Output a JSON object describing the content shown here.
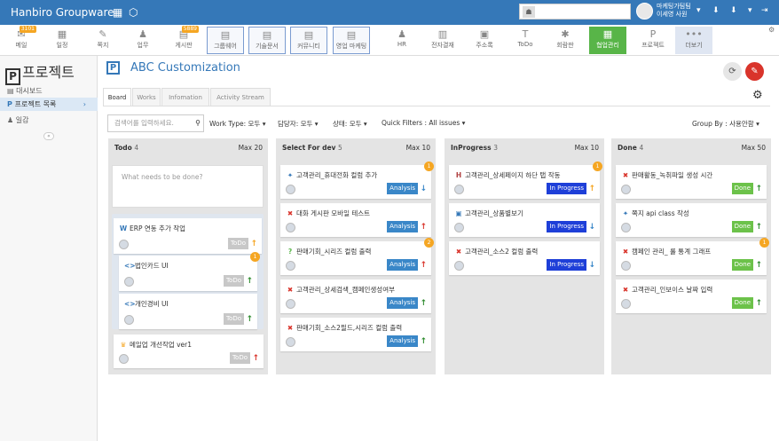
{
  "header": {
    "logo": "Hanbiro Groupware",
    "user_line1": "마케팅가팀팀",
    "user_line2": "이세영 사원"
  },
  "menu": [
    {
      "label": "메일",
      "glyph": "✉",
      "badge": "3101",
      "style": "plain"
    },
    {
      "label": "일정",
      "glyph": "▦",
      "badge": "",
      "style": "plain"
    },
    {
      "label": "쪽지",
      "glyph": "✎",
      "badge": "",
      "style": "plain"
    },
    {
      "label": "업무",
      "glyph": "♟",
      "badge": "",
      "style": "plain"
    },
    {
      "label": "게시판",
      "glyph": "▤",
      "badge": "5889",
      "style": "plain"
    },
    {
      "label": "그룹웨어",
      "glyph": "▤",
      "badge": "",
      "style": "boxed"
    },
    {
      "label": "기술문서",
      "glyph": "▤",
      "badge": "",
      "style": "boxed"
    },
    {
      "label": "커뮤니티",
      "glyph": "▤",
      "badge": "",
      "style": "boxed"
    },
    {
      "label": "영업 마케팅",
      "glyph": "▤",
      "badge": "",
      "style": "boxed"
    },
    {
      "label": "HR",
      "glyph": "♟",
      "badge": "",
      "style": "plain"
    },
    {
      "label": "전자결재",
      "glyph": "▥",
      "badge": "",
      "style": "plain"
    },
    {
      "label": "주소록",
      "glyph": "▣",
      "badge": "",
      "style": "plain"
    },
    {
      "label": "ToDo",
      "glyph": "T",
      "badge": "",
      "style": "plain"
    },
    {
      "label": "회람판",
      "glyph": "✱",
      "badge": "",
      "style": "plain"
    },
    {
      "label": "협업관리",
      "glyph": "▦",
      "badge": "",
      "style": "green"
    },
    {
      "label": "프로젝트",
      "glyph": "P",
      "badge": "",
      "style": "plain"
    },
    {
      "label": "더보기",
      "glyph": "•••",
      "badge": "",
      "style": "light"
    }
  ],
  "sidebar": {
    "title": "프로젝트",
    "items": [
      "대시보드",
      "프로젝트 목록",
      "일감"
    ],
    "collapse": "«"
  },
  "project": {
    "title": "ABC Customization",
    "tabs": [
      "Board",
      "Works",
      "Infomation",
      "Activity Stream"
    ]
  },
  "filters": {
    "search_placeholder": "검색어를 입력하세요.",
    "work_type": "Work Type: 모두 ▾",
    "assignee": "담당자: 모두 ▾",
    "status": "상태: 모두 ▾",
    "quick": "Quick Filters : All issues ▾",
    "group_by": "Group By : 사용안함 ▾"
  },
  "columns": [
    {
      "name": "Todo",
      "count": "4",
      "max": "Max  20",
      "input_placeholder": "What needs to be done?"
    },
    {
      "name": "Select For dev",
      "count": "5",
      "max": "Max  10"
    },
    {
      "name": "InProgress",
      "count": "3",
      "max": "Max  10"
    },
    {
      "name": "Done",
      "count": "4",
      "max": "Max  50"
    }
  ],
  "cards": {
    "todo": [
      {
        "title": "ERP 연동 추가 작업",
        "icon": "W",
        "status": "ToDo",
        "arrow": "↑",
        "badge": ""
      },
      {
        "title": "법인카드 UI",
        "icon": "<>",
        "status": "ToDo",
        "arrow": "↑",
        "badge": "1"
      },
      {
        "title": "개인경비 UI",
        "icon": "<>",
        "status": "ToDo",
        "arrow": "↑",
        "badge": ""
      },
      {
        "title": "메일업 개선작업 ver1",
        "icon": "♛",
        "status": "ToDo",
        "arrow": "↑",
        "badge": ""
      }
    ],
    "dev": [
      {
        "title": "고객관리_휴대전화 컬럼 추가",
        "icon": "✦",
        "status": "Analysis",
        "arrow": "↓",
        "badge": "1"
      },
      {
        "title": "대화 게시판 모바일 테스트",
        "icon": "✖",
        "status": "Analysis",
        "arrow": "↑",
        "badge": ""
      },
      {
        "title": "판매기회_시리즈 컬럼 출력",
        "icon": "?",
        "status": "Analysis",
        "arrow": "↑",
        "badge": "2"
      },
      {
        "title": "고객관리_상세검색_캠페인생성여부",
        "icon": "✖",
        "status": "Analysis",
        "arrow": "↑",
        "badge": ""
      },
      {
        "title": "판매기회_소스2필드,시리즈 컬럼 출력",
        "icon": "✖",
        "status": "Analysis",
        "arrow": "↑",
        "badge": ""
      }
    ],
    "inprog": [
      {
        "title": "고객관리_상세페이지 하단 탭 작동",
        "icon": "H",
        "status": "In Progress",
        "arrow": "↑",
        "badge": "1"
      },
      {
        "title": "고객관리_상품별보기",
        "icon": "▣",
        "status": "In Progress",
        "arrow": "↓",
        "badge": ""
      },
      {
        "title": "고객관리_소스2 컬럼 출력",
        "icon": "✖",
        "status": "In Progress",
        "arrow": "↓",
        "badge": ""
      }
    ],
    "done": [
      {
        "title": "판매활동_녹취파일 생성 시간",
        "icon": "✖",
        "status": "Done",
        "arrow": "↑",
        "badge": ""
      },
      {
        "title": "쪽지 api class 작성",
        "icon": "✦",
        "status": "Done",
        "arrow": "↑",
        "badge": ""
      },
      {
        "title": "캠페인 관리_ 룰 통계 그래프",
        "icon": "✖",
        "status": "Done",
        "arrow": "↑",
        "badge": "1"
      },
      {
        "title": "고객관리_인보이스 날짜 입력",
        "icon": "✖",
        "status": "Done",
        "arrow": "↑",
        "badge": ""
      }
    ]
  },
  "colors": {
    "brand": "#3578b8",
    "analysis": "#3a87c8",
    "inprogress": "#1e3fd8",
    "done": "#6cc24a",
    "todo": "#c8c8c8",
    "bug": "#d9342b",
    "arrow_up_green": "#2e8b2e",
    "arrow_up_red": "#d9342b",
    "arrow_up_orange": "#f5a623",
    "arrow_down_blue": "#3a87c8"
  }
}
